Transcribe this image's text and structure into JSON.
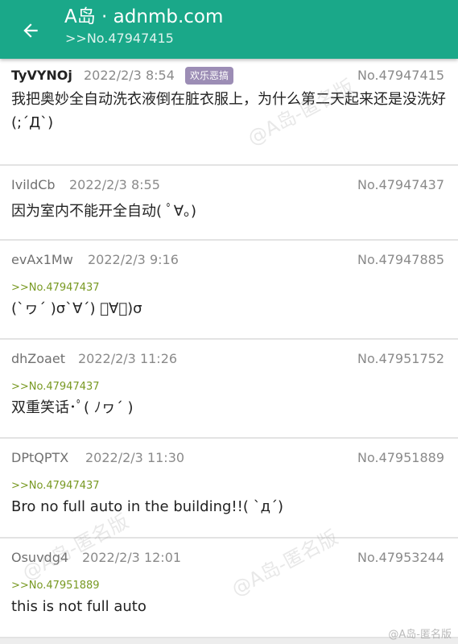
{
  "header": {
    "title": "A岛 · adnmb.com",
    "subtitle": ">>No.47947415"
  },
  "posts": [
    {
      "uid": "TyVYNOj",
      "time": "2022/2/3 8:54",
      "tag": "欢乐恶搞",
      "no": "No.47947415",
      "quote": "",
      "content": "我把奥妙全自动洗衣液倒在脏衣服上，为什么第二天起来还是没洗好(;´Д`)"
    },
    {
      "uid": "IvildCb",
      "time": "2022/2/3 8:55",
      "no": "No.47947437",
      "quote": "",
      "content": "因为室内不能开全自动( ﾟ∀。)"
    },
    {
      "uid": "evAx1Mw",
      "time": "2022/2/3 9:16",
      "no": "No.47947885",
      "quote": ">>No.47947437",
      "content": "(`ヮ´ )σ`∀´) ﾟ∀ﾟ)σ"
    },
    {
      "uid": "dhZoaet",
      "time": "2022/2/3 11:26",
      "no": "No.47951752",
      "quote": ">>No.47947437",
      "content": "双重笑话･ﾟ( ﾉヮ´ )"
    },
    {
      "uid": "DPtQPTX",
      "time": "2022/2/3 11:30",
      "no": "No.47951889",
      "quote": ">>No.47947437",
      "content": "Bro no full auto in the building!!( `д´)"
    },
    {
      "uid": "Osuvdg4",
      "time": "2022/2/3 12:01",
      "no": "No.47953244",
      "quote": ">>No.47951889",
      "content": "this is not full auto"
    }
  ],
  "watermark": {
    "text": "@A岛-匿名版",
    "footer": "@A岛-匿名版"
  },
  "colors": {
    "appbar": "#1aa889",
    "quote": "#789922",
    "tag": "#9c8db5"
  }
}
